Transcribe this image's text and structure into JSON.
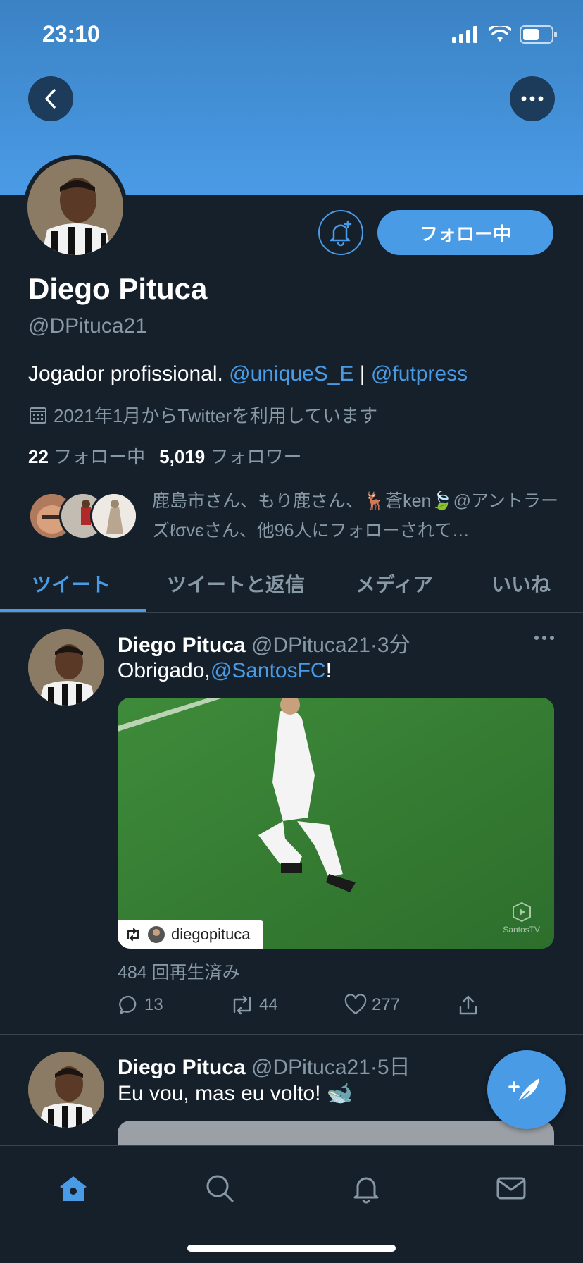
{
  "status_bar": {
    "time": "23:10"
  },
  "profile": {
    "name": "Diego Pituca",
    "handle": "@DPituca21",
    "follow_label": "フォロー中",
    "bio_text": "Jogador profissional.",
    "bio_link1": "@uniqueS_E",
    "bio_separator": "|",
    "bio_link2": "@futpress",
    "joined": "2021年1月からTwitterを利用しています",
    "following_count": "22",
    "following_label": "フォロー中",
    "followers_count": "5,019",
    "followers_label": "フォロワー",
    "known_followers_text": "鹿島市さん、もり鹿さん、🦌蒼ken🍃@アントラーズℓσvєさん、他96人にフォローされて…"
  },
  "tabs": [
    {
      "label": "ツイート",
      "active": true
    },
    {
      "label": "ツイートと返信",
      "active": false
    },
    {
      "label": "メディア",
      "active": false
    },
    {
      "label": "いいね",
      "active": false
    }
  ],
  "tweets": [
    {
      "name": "Diego Pituca",
      "handle_time": "@DPituca21·3分",
      "text_prefix": "Obrigado,",
      "text_link": "@SantosFC",
      "text_suffix": "!",
      "media_tag": "diegopituca",
      "media_watermark": "SantosTV",
      "views": "484 回再生済み",
      "replies": "13",
      "retweets": "44",
      "likes": "277"
    },
    {
      "name": "Diego Pituca",
      "handle_time": "@DPituca21·5日",
      "text": "Eu vou, mas eu volto! 🐋"
    }
  ],
  "colors": {
    "accent": "#4a9be6",
    "background": "#15202b",
    "secondary_text": "#8899a6",
    "divider": "#38444d"
  },
  "icons": [
    "back-icon",
    "more-icon",
    "bell-plus-icon",
    "calendar-icon",
    "reply-icon",
    "retweet-icon",
    "like-icon",
    "share-icon",
    "compose-icon",
    "home-icon",
    "search-icon",
    "notifications-icon",
    "messages-icon"
  ]
}
